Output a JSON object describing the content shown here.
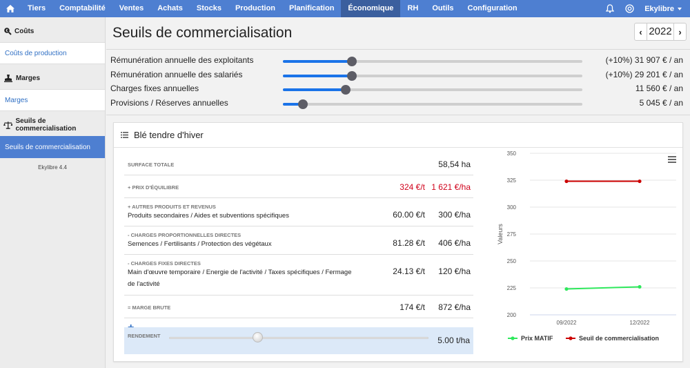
{
  "nav": {
    "items": [
      "Tiers",
      "Comptabilité",
      "Ventes",
      "Achats",
      "Stocks",
      "Production",
      "Planification",
      "Économique",
      "RH",
      "Outils",
      "Configuration"
    ],
    "active": "Économique",
    "user": "Ekylibre",
    "accent": "#4e7fd1"
  },
  "sidebar": {
    "sections": [
      {
        "title": "Coûts",
        "icon": "search-money-icon",
        "links": [
          "Coûts de production"
        ]
      },
      {
        "title": "Marges",
        "icon": "stamp-icon",
        "links": [
          "Marges"
        ]
      },
      {
        "title": "Seuils de commercialisation",
        "icon": "scale-icon",
        "links": [
          "Seuils de commercialisation"
        ]
      }
    ],
    "version": "Ekylibre 4.4"
  },
  "page": {
    "title": "Seuils de commercialisation",
    "year": "2022"
  },
  "sliders": [
    {
      "label": "Rémunération annuelle des exploitants",
      "value": "(+10%) 31 907 € / an",
      "level": 0.23
    },
    {
      "label": "Rémunération annuelle des salariés",
      "value": "(+10%) 29 201 € / an",
      "level": 0.23
    },
    {
      "label": "Charges fixes annuelles",
      "value": "11 560 € / an",
      "level": 0.21
    },
    {
      "label": "Provisions / Réserves annuelles",
      "value": "5 045 € / an",
      "level": 0.066
    }
  ],
  "card": {
    "title": "Blé tendre d'hiver",
    "rows": [
      {
        "cap": "SURFACE TOTALE",
        "desc": "",
        "c1": "",
        "c2": "58,54 ha",
        "red": false
      },
      {
        "cap": "+ PRIX D'ÉQUILIBRE",
        "desc": "",
        "c1": "324 €/t",
        "c2": "1 621 €/ha",
        "red": true
      },
      {
        "cap": "+ AUTRES PRODUITS ET REVENUS",
        "desc": "Produits secondaires / Aides et subventions spécifiques",
        "c1": "60.00 €/t",
        "c2": "300 €/ha",
        "red": false
      },
      {
        "cap": "- CHARGES PROPORTIONNELLES DIRECTES",
        "desc": "Semences / Fertilisants / Protection des végétaux",
        "c1": "81.28 €/t",
        "c2": "406 €/ha",
        "red": false
      },
      {
        "cap": "- CHARGES FIXES DIRECTES",
        "desc": "Main d'œuvre temporaire / Energie de l'activité / Taxes spécifiques / Fermage de l'activité",
        "c1": "24.13 €/t",
        "c2": "120 €/ha",
        "red": false
      },
      {
        "cap": "= MARGE BRUTE",
        "desc": "",
        "c1": "174 €/t",
        "c2": "872 €/ha",
        "red": false
      }
    ],
    "rendement": {
      "cap": "RENDEMENT",
      "value": "5.00 t/ha",
      "level": 0.34
    }
  },
  "chart_data": {
    "type": "line",
    "categories": [
      "09/2022",
      "12/2022"
    ],
    "ylabel": "Valeurs",
    "ylim": [
      200,
      350
    ],
    "yticks": [
      "200",
      "225",
      "250",
      "275",
      "300",
      "325",
      "350"
    ],
    "series": [
      {
        "name": "Prix MATIF",
        "values": [
          224,
          226
        ],
        "color": "#2ee85c"
      },
      {
        "name": "Seuil de commercialisation",
        "values": [
          324,
          324
        ],
        "color": "#cc0000"
      }
    ],
    "legend": "bottom"
  }
}
